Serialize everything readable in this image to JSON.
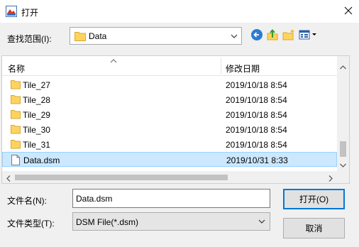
{
  "window": {
    "title": "打开",
    "icon": "app-icon"
  },
  "lookin": {
    "label": "查找范围(I):",
    "value": "Data"
  },
  "columns": {
    "name": "名称",
    "date": "修改日期"
  },
  "files": [
    {
      "name": "Tile_27",
      "date": "2019/10/18 8:54",
      "type": "folder",
      "selected": false
    },
    {
      "name": "Tile_28",
      "date": "2019/10/18 8:54",
      "type": "folder",
      "selected": false
    },
    {
      "name": "Tile_29",
      "date": "2019/10/18 8:54",
      "type": "folder",
      "selected": false
    },
    {
      "name": "Tile_30",
      "date": "2019/10/18 8:54",
      "type": "folder",
      "selected": false
    },
    {
      "name": "Tile_31",
      "date": "2019/10/18 8:54",
      "type": "folder",
      "selected": false
    },
    {
      "name": "Data.dsm",
      "date": "2019/10/31 8:33",
      "type": "file",
      "selected": true
    }
  ],
  "filename": {
    "label": "文件名(N):",
    "value": "Data.dsm"
  },
  "filetype": {
    "label": "文件类型(T):",
    "value": "DSM File(*.dsm)"
  },
  "buttons": {
    "open": "打开(O)",
    "cancel": "取消"
  },
  "colors": {
    "selection": "#cce8ff",
    "accent": "#0078d7",
    "folder": "#ffd35e"
  }
}
